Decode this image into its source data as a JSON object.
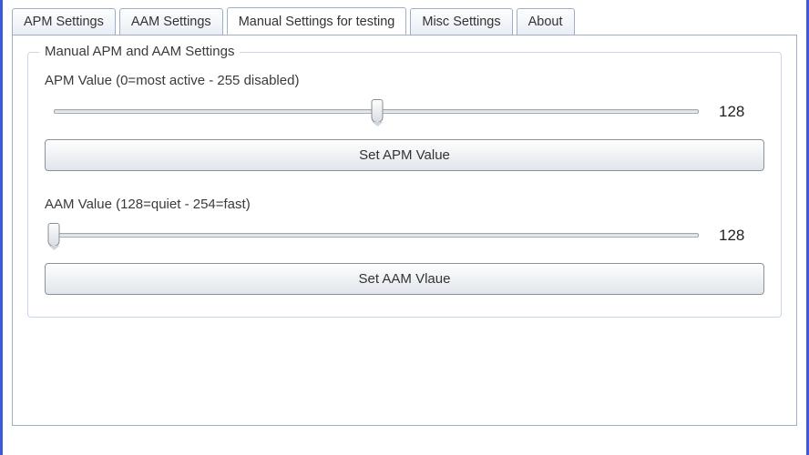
{
  "tabs": {
    "items": [
      {
        "label": "APM Settings"
      },
      {
        "label": "AAM Settings"
      },
      {
        "label": "Manual Settings for testing"
      },
      {
        "label": "Misc Settings"
      },
      {
        "label": "About"
      }
    ],
    "active_index": 2
  },
  "group": {
    "title": "Manual APM and AAM Settings"
  },
  "apm": {
    "label": "APM Value (0=most active - 255 disabled)",
    "value": 128,
    "min": 0,
    "max": 255,
    "button_label": "Set APM Value"
  },
  "aam": {
    "label": "AAM Value (128=quiet - 254=fast)",
    "value": 128,
    "min": 128,
    "max": 254,
    "button_label": "Set AAM Vlaue"
  }
}
